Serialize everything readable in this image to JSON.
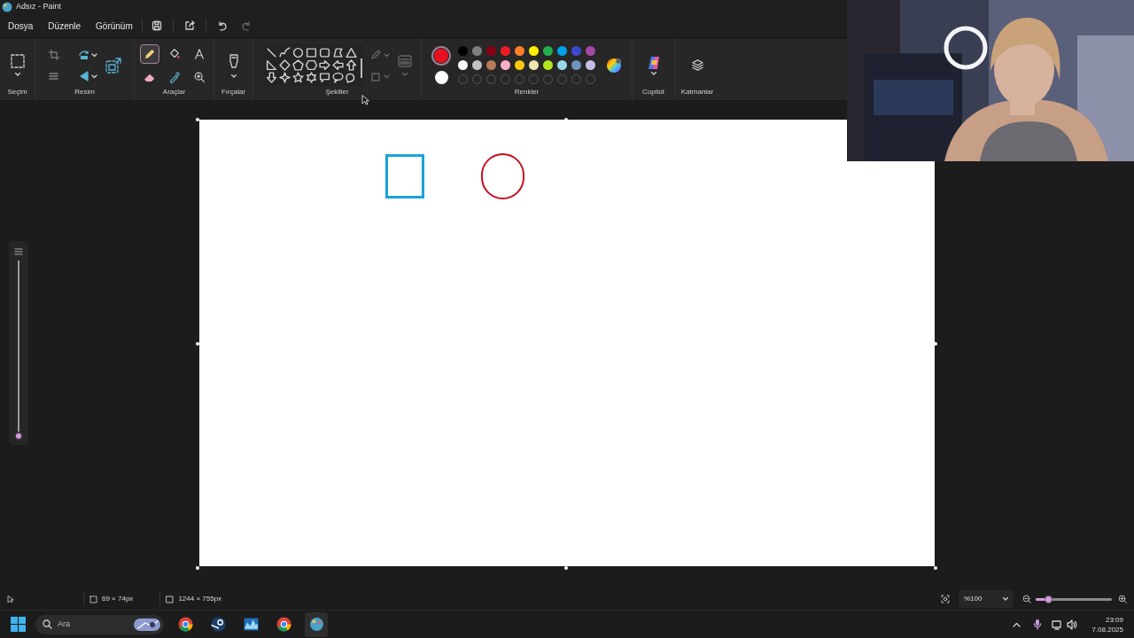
{
  "window": {
    "title": "Adsız - Paint"
  },
  "menu": [
    {
      "label": "Dosya"
    },
    {
      "label": "Düzenle"
    },
    {
      "label": "Görünüm"
    }
  ],
  "ribbon": {
    "groups": [
      "Seçim",
      "Resim",
      "Araçlar",
      "Fırçalar",
      "Şekiller",
      "Renkler",
      "Copilot",
      "Katmanlar"
    ],
    "tools": [
      {
        "kind": "pencil",
        "selected": true
      },
      {
        "kind": "fill",
        "selected": false
      },
      {
        "kind": "text",
        "selected": false
      },
      {
        "kind": "eraser",
        "selected": false
      },
      {
        "kind": "picker",
        "selected": false
      },
      {
        "kind": "magnifier",
        "selected": false
      }
    ],
    "primary_color": {
      "color": "#e81123"
    },
    "secondary_color": {
      "color": "#ffffff"
    },
    "palette": [
      {
        "color": "#000000"
      },
      {
        "color": "#7f7f7f"
      },
      {
        "color": "#880015"
      },
      {
        "color": "#ed1c24"
      },
      {
        "color": "#ff7f27"
      },
      {
        "color": "#fff200"
      },
      {
        "color": "#22b14c"
      },
      {
        "color": "#00a2e8"
      },
      {
        "color": "#3f48cc"
      },
      {
        "color": "#a349a4"
      },
      {
        "color": "#ffffff"
      },
      {
        "color": "#c3c3c3"
      },
      {
        "color": "#b97a57"
      },
      {
        "color": "#ffaec9"
      },
      {
        "color": "#ffc90e"
      },
      {
        "color": "#efe4b0"
      },
      {
        "color": "#b5e61d"
      },
      {
        "color": "#99d9ea"
      },
      {
        "color": "#7092be"
      },
      {
        "color": "#c8bfe7"
      }
    ]
  },
  "brush_size": {
    "level": 0
  },
  "canvas": {
    "shapes": [
      {
        "kind": "rectangle",
        "color": "#1aa3d9"
      },
      {
        "kind": "ellipse",
        "color": "#c50f1f"
      }
    ]
  },
  "status_bar": {
    "selection_size": "69 × 74px",
    "canvas_size": "1244 × 755px",
    "zoom": "%100",
    "zoom_level": {
      "level": 0.16
    }
  },
  "taskbar": {
    "search_placeholder": "Ara",
    "time": "23:09",
    "date": "7.08.2025"
  }
}
